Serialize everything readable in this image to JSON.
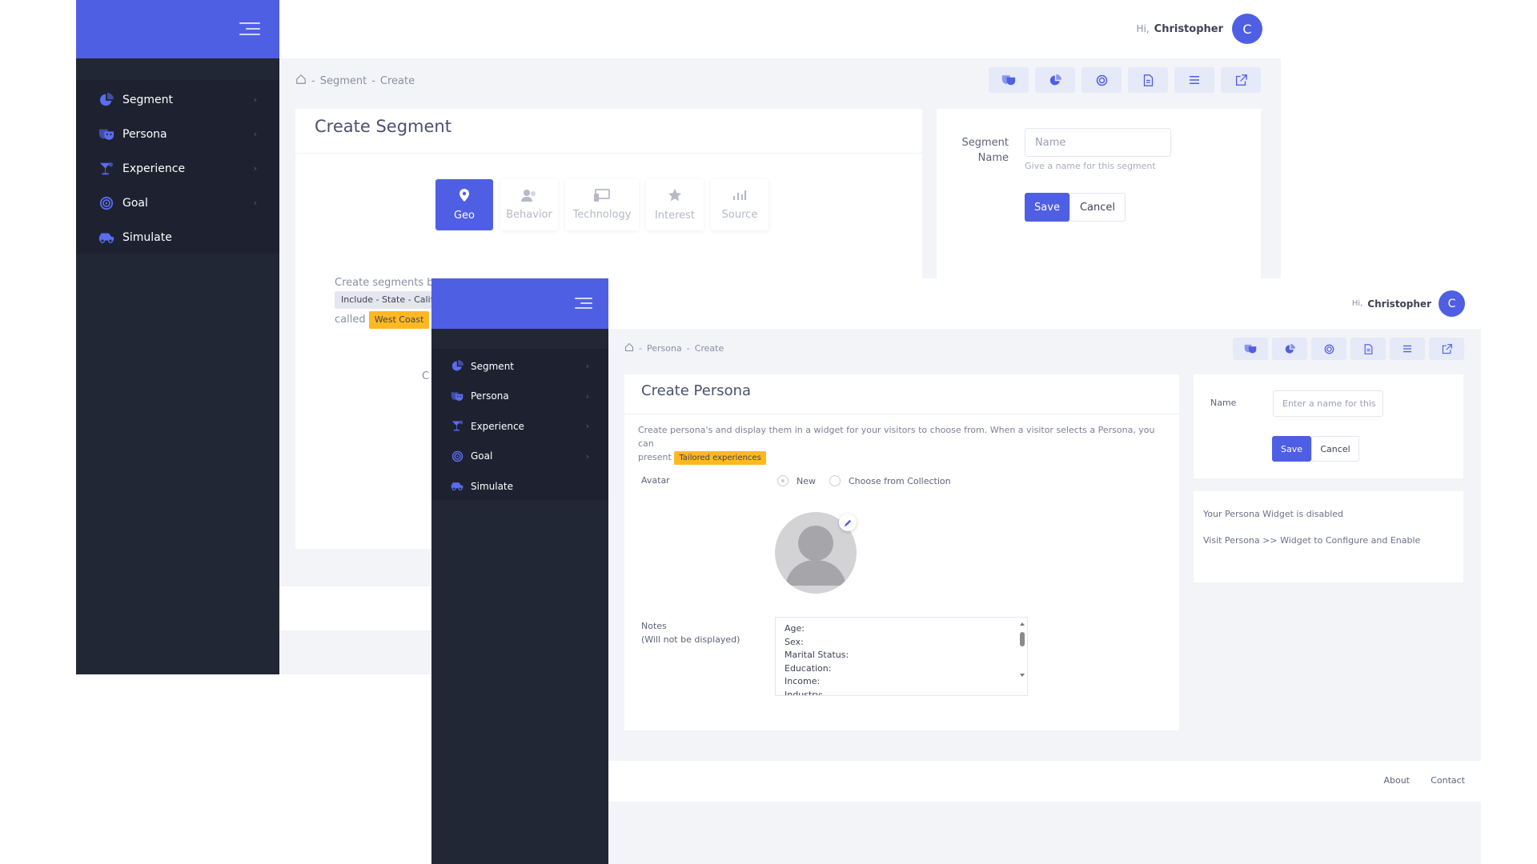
{
  "user": {
    "greeting": "Hi,",
    "name": "Christopher",
    "initial": "C"
  },
  "nav": [
    {
      "label": "Segment",
      "icon": "pie-chart-icon",
      "chevron": true
    },
    {
      "label": "Persona",
      "icon": "mask-icon",
      "chevron": true
    },
    {
      "label": "Experience",
      "icon": "cocktail-icon",
      "chevron": true
    },
    {
      "label": "Goal",
      "icon": "target-icon",
      "chevron": true
    },
    {
      "label": "Simulate",
      "icon": "car-icon",
      "chevron": false
    }
  ],
  "chevron": "›",
  "toolbar_icons": [
    "mask-icon",
    "pie-chart-icon",
    "target-icon",
    "document-icon",
    "list-icon",
    "external-link-icon"
  ],
  "segment_window": {
    "breadcrumb": {
      "sep1": "-",
      "section": "Segment",
      "sep2": "-",
      "page": "Create"
    },
    "title": "Create Segment",
    "tabs": [
      {
        "label": "Geo",
        "icon": "map-pin-icon",
        "active": true
      },
      {
        "label": "Behavior",
        "icon": "users-icon",
        "active": false
      },
      {
        "label": "Technology",
        "icon": "devices-icon",
        "active": false
      },
      {
        "label": "Interest",
        "icon": "star-icon",
        "active": false
      },
      {
        "label": "Source",
        "icon": "bar-chart-icon",
        "active": false
      }
    ],
    "description_start": "Create segments b",
    "rule_tag": "Include - State - Calif",
    "called_text": "called",
    "name_tag": "West Coast",
    "cut_text": "C",
    "form": {
      "label_line1": "Segment",
      "label_line2": "Name",
      "placeholder": "Name",
      "hint": "Give a name for this segment",
      "save": "Save",
      "cancel": "Cancel"
    }
  },
  "persona_window": {
    "breadcrumb": {
      "sep1": "-",
      "section": "Persona",
      "sep2": "-",
      "page": "Create"
    },
    "title": "Create Persona",
    "description_line1": "Create persona's and display them in a widget for your visitors to choose from. When a visitor selects a Persona, you can",
    "description_line2": "present",
    "desc_tag": "Tailored experiences",
    "avatar_label": "Avatar",
    "radio_new": "New",
    "radio_collection": "Choose from Collection",
    "notes_label": "Notes",
    "notes_sublabel": "(Will not be displayed)",
    "notes_value": "Age:\nSex:\nMarital Status:\nEducation:\nIncome:\nIndustry:",
    "form": {
      "name_label": "Name",
      "placeholder": "Enter a name for this",
      "save": "Save",
      "cancel": "Cancel"
    },
    "widget_status": "Your Persona Widget is disabled",
    "widget_hint": "Visit Persona >> Widget to Configure and Enable",
    "footer": {
      "about": "About",
      "contact": "Contact"
    }
  }
}
